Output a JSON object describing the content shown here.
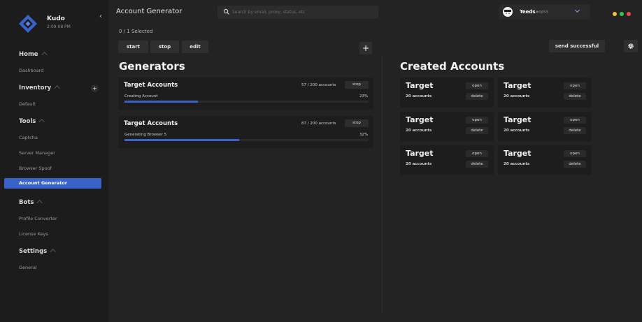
{
  "sidebar": {
    "app_name": "Kudo",
    "time": "2:09:08 PM",
    "sections": [
      {
        "label": "Home",
        "items": [
          "Dashboard"
        ]
      },
      {
        "label": "Inventory",
        "items": [
          "Default"
        ]
      },
      {
        "label": "Tools",
        "items": [
          "Captcha",
          "Server Manager",
          "Browser Spoof",
          "Account Generator"
        ]
      },
      {
        "label": "Bots",
        "items": [
          "Profile Converter",
          "License Keys"
        ]
      },
      {
        "label": "Settings",
        "items": [
          "General"
        ]
      }
    ],
    "inventory_add": "+"
  },
  "header": {
    "title": "Account Generator",
    "search_placeholder": "Search by email, proxy, status, etc",
    "user": {
      "name": "Teeds",
      "tag": "#6855"
    },
    "window_colors": [
      "#f5bf2f",
      "#2fc84a",
      "#f0464a"
    ]
  },
  "toolbar": {
    "selected": "0 / 1 Selected",
    "start": "start",
    "stop": "stop",
    "edit": "edit",
    "plus": "+",
    "send_successful": "send successful"
  },
  "generators": {
    "title": "Generators",
    "items": [
      {
        "name": "Target Accounts",
        "count": "57 / 200 accounts",
        "stop": "stop",
        "status": "Creating Account",
        "percent": "23%",
        "progress": 0.3
      },
      {
        "name": "Target Accounts",
        "count": "87 / 200 accounts",
        "stop": "stop",
        "status": "Generating Browser 5",
        "percent": "32%",
        "progress": 0.47
      }
    ]
  },
  "created": {
    "title": "Created Accounts",
    "cards": [
      {
        "name": "Target",
        "count": "20 accounts",
        "open": "open",
        "delete": "delete"
      },
      {
        "name": "Target",
        "count": "20 accounts",
        "open": "open",
        "delete": "delete"
      },
      {
        "name": "Target",
        "count": "20 accounts",
        "open": "open",
        "delete": "delete"
      },
      {
        "name": "Target",
        "count": "20 accounts",
        "open": "open",
        "delete": "delete"
      },
      {
        "name": "Target",
        "count": "20 accounts",
        "open": "open",
        "delete": "delete"
      },
      {
        "name": "Target",
        "count": "20 accounts",
        "open": "open",
        "delete": "delete"
      }
    ]
  },
  "colors": {
    "accent": "#3a63c9",
    "background": "#232323",
    "sidebar": "#1c1c1c",
    "card": "#1d1d1d"
  }
}
